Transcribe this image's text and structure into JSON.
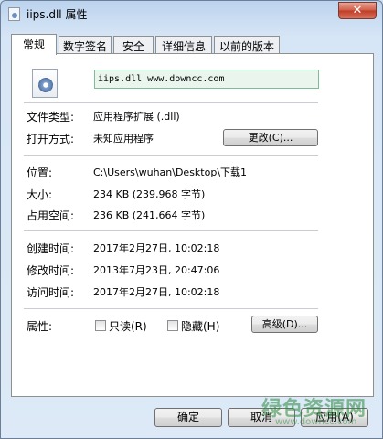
{
  "window": {
    "title": "iips.dll 属性",
    "close_label": "✕"
  },
  "tabs": [
    "常规",
    "数字签名",
    "安全",
    "详细信息",
    "以前的版本"
  ],
  "general": {
    "filename": "iips.dll  www.downcc.com",
    "file_type_label": "文件类型:",
    "file_type_value": "应用程序扩展 (.dll)",
    "open_with_label": "打开方式:",
    "open_with_value": "未知应用程序",
    "change_button": "更改(C)...",
    "location_label": "位置:",
    "location_value": "C:\\Users\\wuhan\\Desktop\\下载1",
    "size_label": "大小:",
    "size_value": "234 KB (239,968 字节)",
    "size_on_disk_label": "占用空间:",
    "size_on_disk_value": "236 KB (241,664 字节)",
    "created_label": "创建时间:",
    "created_value": "2017年2月27日, 10:02:18",
    "modified_label": "修改时间:",
    "modified_value": "2013年7月23日, 20:47:06",
    "accessed_label": "访问时间:",
    "accessed_value": "2017年2月27日, 10:02:18",
    "attributes_label": "属性:",
    "readonly_label": "只读(R)",
    "hidden_label": "隐藏(H)",
    "advanced_button": "高级(D)..."
  },
  "footer": {
    "ok": "确定",
    "cancel": "取消",
    "apply": "应用(A)"
  },
  "watermark": {
    "main": "绿色资源网",
    "sub": "www.downcc.com"
  }
}
